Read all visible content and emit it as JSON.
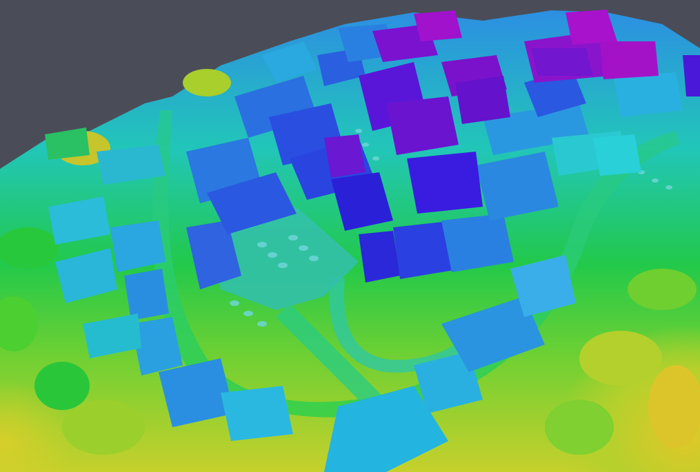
{
  "viewer": {
    "background": "#4a4d57",
    "colormap": {
      "name": "elevation-gradient",
      "stops": [
        "#c8cf2a",
        "#8ccf2a",
        "#2fc83a",
        "#1fc8b0",
        "#2aa8e0",
        "#2f63e0",
        "#2a1fd8",
        "#6a12d0",
        "#a412d0"
      ]
    }
  }
}
